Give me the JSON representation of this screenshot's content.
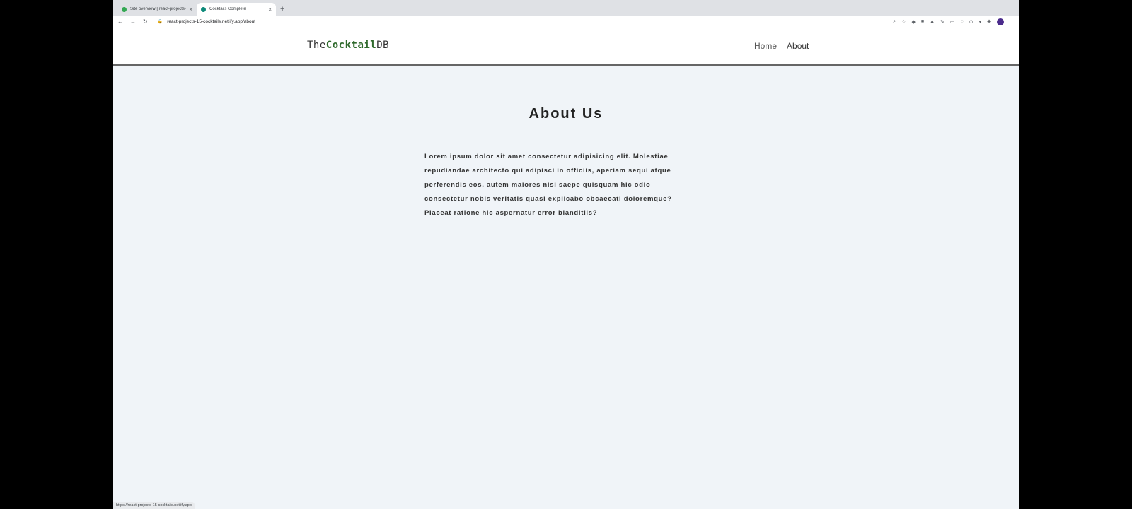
{
  "browser": {
    "tabs": [
      {
        "title": "Site overview | react-projects-",
        "active": false,
        "favicon_color": "#34a853"
      },
      {
        "title": "Cocktails Complete",
        "active": true,
        "favicon_color": "#0e8a7a"
      }
    ],
    "url": "react-projects-15-cocktails.netlify.app/about",
    "status_url": "https://react-projects-15-cocktails.netlify.app"
  },
  "site": {
    "logo": {
      "part1": "The",
      "part2": "Cocktail",
      "part3": "DB"
    },
    "nav": {
      "home": "Home",
      "about": "About"
    }
  },
  "page": {
    "title": "About Us",
    "body": "Lorem ipsum dolor sit amet consectetur adipisicing elit. Molestiae repudiandae architecto qui adipisci in officiis, aperiam sequi atque perferendis eos, autem maiores nisi saepe quisquam hic odio consectetur nobis veritatis quasi explicabo obcaecati doloremque? Placeat ratione hic aspernatur error blanditiis?"
  },
  "colors": {
    "accent": "#2f6a2c",
    "page_bg": "#f0f4f8"
  }
}
